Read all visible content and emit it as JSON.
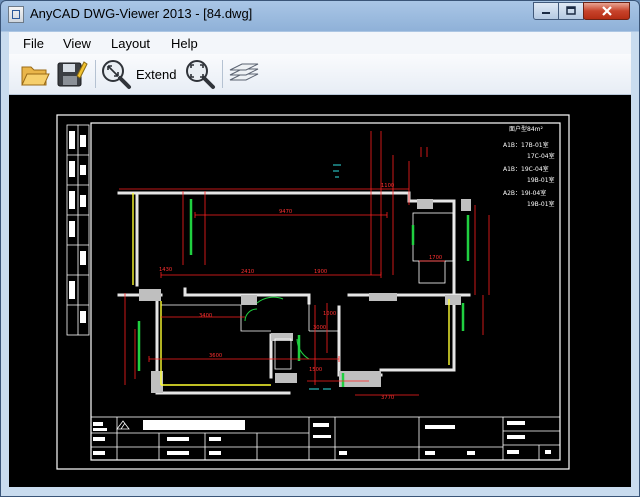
{
  "window": {
    "title": "AnyCAD DWG-Viewer 2013 - [84.dwg]"
  },
  "menu": [
    {
      "label": "File"
    },
    {
      "label": "View"
    },
    {
      "label": "Layout"
    },
    {
      "label": "Help"
    }
  ],
  "toolbar": {
    "extend_label": "Extend"
  },
  "drawing": {
    "legend_title": "面户型84m²",
    "legend_rows": [
      "A1B：17B-01室",
      "17C-04室",
      "A1B：19C-04室",
      "19B-01室",
      "A2B：19I-04室",
      "19B-01室"
    ],
    "dimensions": [
      "9470",
      "3400",
      "2410",
      "1900",
      "3600",
      "1430",
      "1700",
      "3770",
      "1000",
      "1500",
      "1100",
      "3000"
    ]
  },
  "colors": {
    "canvas": "#000000",
    "wall": "#ffffff",
    "dimension_red": "#ff2020",
    "window_green": "#20d040",
    "yellow": "#ffff30",
    "cyan": "#30e0e0"
  }
}
